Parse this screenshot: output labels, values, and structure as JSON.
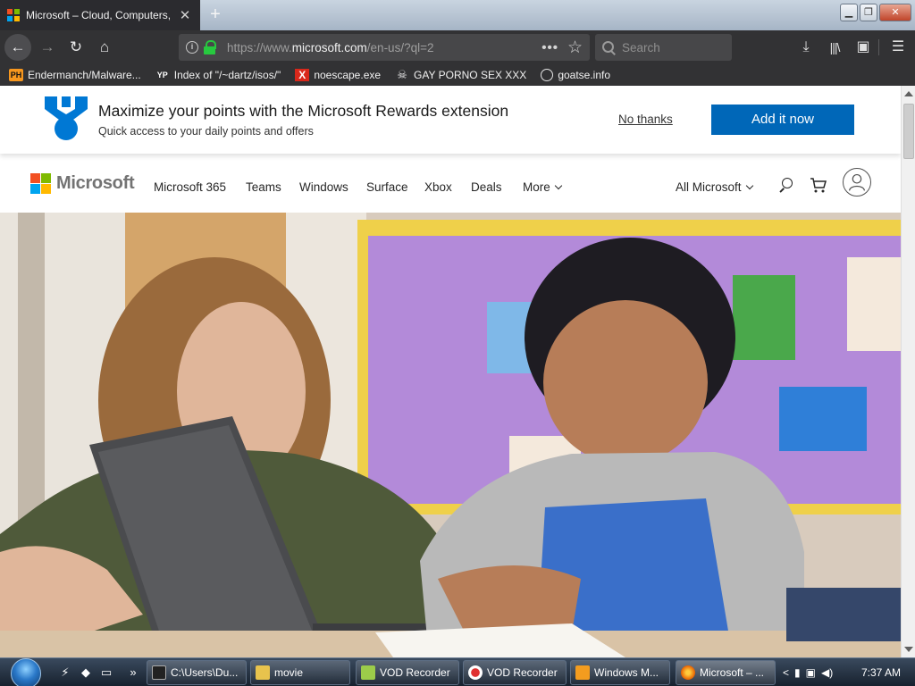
{
  "browser": {
    "tab": {
      "title": "Microsoft – Cloud, Computers,",
      "close": "✕"
    },
    "new_tab": "+",
    "window_controls": {
      "minimize": "▁",
      "maximize": "❐",
      "close": "✕"
    },
    "toolbar": {
      "back_icon": "←",
      "forward_icon": "→",
      "reload_icon": "↻",
      "home_icon": "⌂",
      "url_prefix": "https://www.",
      "url_domain": "microsoft.com",
      "url_path": "/en-us/?ql=2",
      "page_actions": "•••",
      "bookmark_star": "☆",
      "search_placeholder": "Search",
      "downloads_icon": "⤓",
      "library_icon": "|||\\",
      "sidebar_icon": "▣",
      "menu_icon": "☰"
    },
    "bookmarks": [
      {
        "icon": "PH",
        "label": "Endermanch/Malware..."
      },
      {
        "icon": "YP",
        "label": "Index of \"/~dartz/isos/\""
      },
      {
        "icon": "X",
        "label": "noescape.exe"
      },
      {
        "icon": "☠",
        "label": "GAY PORNO SEX XXX"
      },
      {
        "icon": "",
        "label": "goatse.info"
      }
    ]
  },
  "page": {
    "rewards": {
      "title": "Maximize your points with the Microsoft Rewards extension",
      "subtitle": "Quick access to your daily points and offers",
      "dismiss": "No thanks",
      "cta": "Add it now"
    },
    "header": {
      "logo_text": "Microsoft",
      "nav": [
        "Microsoft 365",
        "Teams",
        "Windows",
        "Surface",
        "Xbox",
        "Deals",
        "More"
      ],
      "all_microsoft": "All Microsoft"
    },
    "colors": {
      "ms_red": "#f25022",
      "ms_green": "#7fba00",
      "ms_blue": "#00a4ef",
      "ms_yellow": "#ffb900",
      "rewards_blue": "#0067b8"
    }
  },
  "taskbar": {
    "buttons": [
      {
        "icon": "cmd-icon",
        "label": "C:\\Users\\Du..."
      },
      {
        "icon": "folder-icon",
        "label": "movie"
      },
      {
        "icon": "app-icon",
        "label": "VOD Recorder"
      },
      {
        "icon": "record-icon",
        "label": "VOD Recorder"
      },
      {
        "icon": "media-icon",
        "label": "Windows M..."
      },
      {
        "icon": "firefox-icon",
        "label": "Microsoft – ..."
      }
    ],
    "tray_expand": "<",
    "clock": "7:37 AM",
    "quicklaunch_more": "»"
  }
}
